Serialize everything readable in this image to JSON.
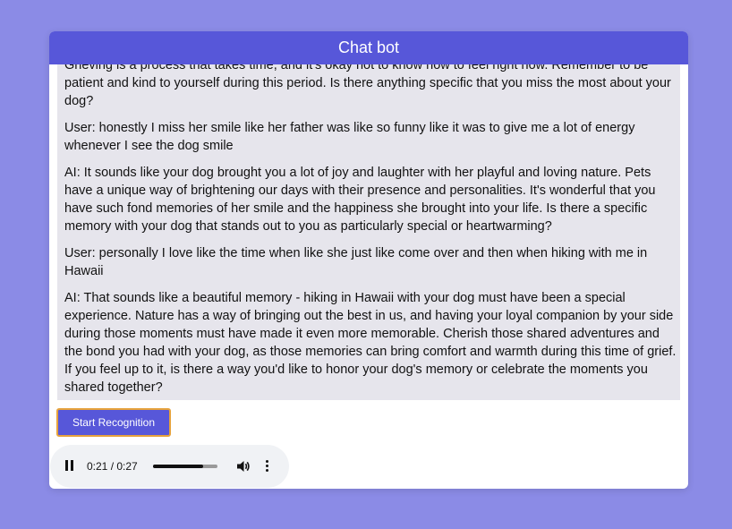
{
  "header": {
    "title": "Chat bot"
  },
  "messages": [
    "Grieving is a process that takes time, and it's okay not to know how to feel right now. Remember to be patient and kind to yourself during this period. Is there anything specific that you miss the most about your dog?",
    "User: honestly I miss her smile like her father was like so funny like it was to give me a lot of energy whenever I see the dog smile",
    "AI: It sounds like your dog brought you a lot of joy and laughter with her playful and loving nature. Pets have a unique way of brightening our days with their presence and personalities. It's wonderful that you have such fond memories of her smile and the happiness she brought into your life. Is there a specific memory with your dog that stands out to you as particularly special or heartwarming?",
    "User: personally I love like the time when like she just like come over and then when hiking with me in Hawaii",
    "AI: That sounds like a beautiful memory - hiking in Hawaii with your dog must have been a special experience. Nature has a way of bringing out the best in us, and having your loyal companion by your side during those moments must have made it even more memorable. Cherish those shared adventures and the bond you had with your dog, as those memories can bring comfort and warmth during this time of grief. If you feel up to it, is there a way you'd like to honor your dog's memory or celebrate the moments you shared together?"
  ],
  "controls": {
    "start_recognition_label": "Start Recognition"
  },
  "audio_player": {
    "time_display": "0:21 / 0:27",
    "progress_fraction": 0.7778,
    "icons": [
      "pause-icon",
      "volume-icon",
      "more-options-icon"
    ]
  },
  "colors": {
    "background": "#8b8be6",
    "accent": "#5757d9",
    "chat_bg": "#e6e5ec",
    "button_border": "#e6a23c"
  }
}
